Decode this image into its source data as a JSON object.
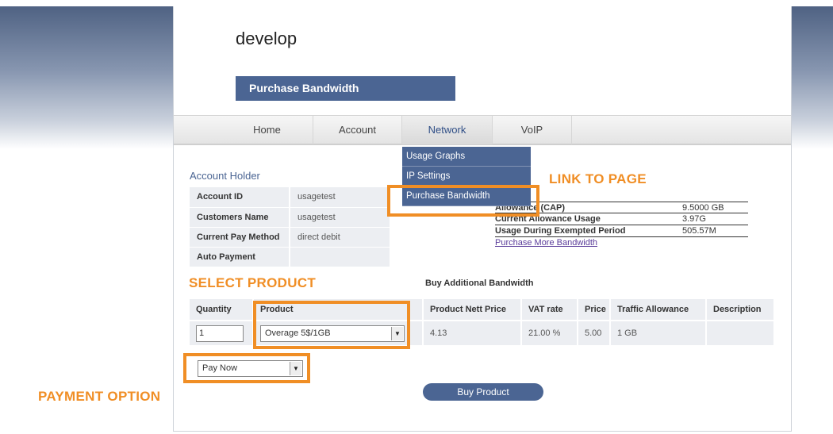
{
  "site": {
    "title": "develop"
  },
  "page": {
    "banner": "Purchase Bandwidth"
  },
  "nav": {
    "items": [
      {
        "label": "Home"
      },
      {
        "label": "Account"
      },
      {
        "label": "Network"
      },
      {
        "label": "VoIP"
      }
    ],
    "active": "Network"
  },
  "dropdown": {
    "items": [
      {
        "label": "Usage Graphs"
      },
      {
        "label": "IP Settings"
      },
      {
        "label": "Purchase Bandwidth"
      }
    ]
  },
  "account": {
    "title": "Account Holder",
    "rows": [
      {
        "label": "Account ID",
        "value": "usagetest"
      },
      {
        "label": "Customers Name",
        "value": "usagetest"
      },
      {
        "label": "Current Pay Method",
        "value": "direct debit"
      },
      {
        "label": "Auto Payment",
        "value": ""
      }
    ]
  },
  "usage": {
    "rows": [
      {
        "label": "Allowance (CAP)",
        "value": "9.5000 GB"
      },
      {
        "label": "Current Allowance Usage",
        "value": "3.97G"
      },
      {
        "label": "Usage During Exempted Period",
        "value": "505.57M"
      }
    ],
    "link": "Purchase More Bandwidth"
  },
  "buy": {
    "heading": "Buy Additional Bandwidth",
    "columns": [
      "Quantity",
      "Product",
      "Product Nett Price",
      "VAT rate",
      "Price",
      "Traffic Allowance",
      "Description"
    ],
    "quantity": "1",
    "product_selected": "Overage 5$/1GB",
    "nett_price": "4.13",
    "vat_rate": "21.00 %",
    "price": "5.00",
    "traffic_allowance": "1 GB",
    "description": ""
  },
  "payment": {
    "selected": "Pay Now"
  },
  "actions": {
    "buy_label": "Buy Product"
  },
  "annotations": {
    "link_to_page": "LINK TO PAGE",
    "select_product": "SELECT PRODUCT",
    "payment_option": "PAYMENT OPTION",
    "color": "#f08e25"
  },
  "colors": {
    "brand": "#4b6593"
  }
}
